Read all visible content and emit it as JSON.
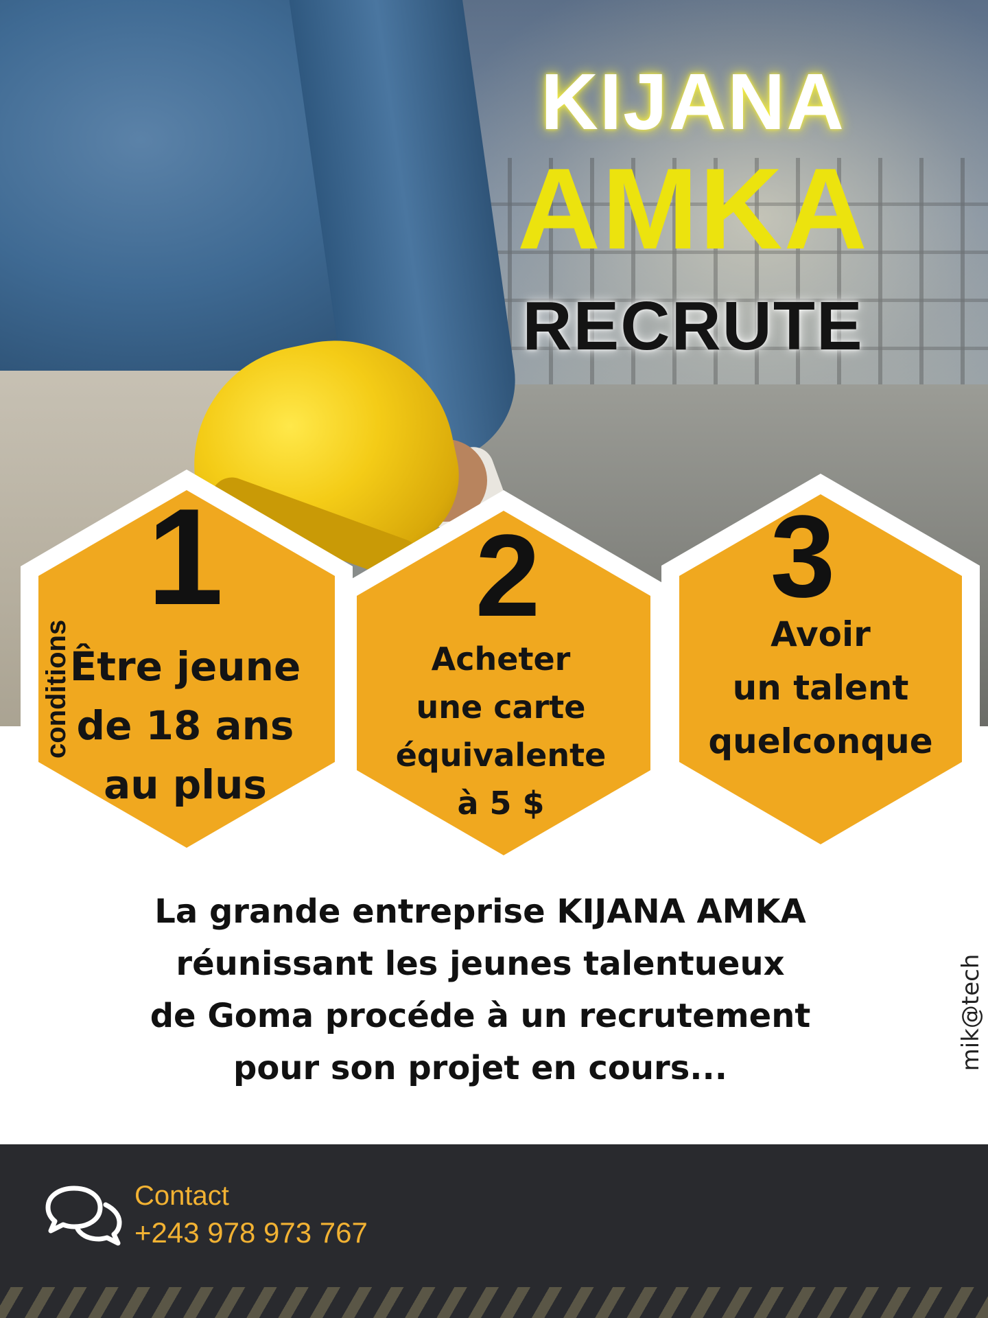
{
  "headline": {
    "line1": "KIJANA",
    "line2": "AMKA",
    "line3": "RECRUTE"
  },
  "conditions_label": "conditions",
  "conditions": [
    {
      "number": "1",
      "lines": [
        "Être jeune",
        "de 18 ans",
        "au plus"
      ]
    },
    {
      "number": "2",
      "lines": [
        "Acheter",
        "une carte",
        "équivalente",
        "à 5 $"
      ]
    },
    {
      "number": "3",
      "lines": [
        "Avoir",
        "un talent",
        "quelconque"
      ]
    }
  ],
  "description": {
    "lines": [
      "La grande entreprise KIJANA AMKA",
      "réunissant les jeunes talentueux",
      "de Goma procéde à un recrutement",
      "pour son projet en cours..."
    ]
  },
  "credit": "mik@tech",
  "footer": {
    "icon": "chat-bubbles-icon",
    "contact_label": "Contact",
    "phone": "+243 978 973 767"
  },
  "colors": {
    "hex_fill": "#f0a81f",
    "headline_yellow": "#ece30e",
    "footer_bg": "#292a2e",
    "contact_text": "#f2b233"
  }
}
